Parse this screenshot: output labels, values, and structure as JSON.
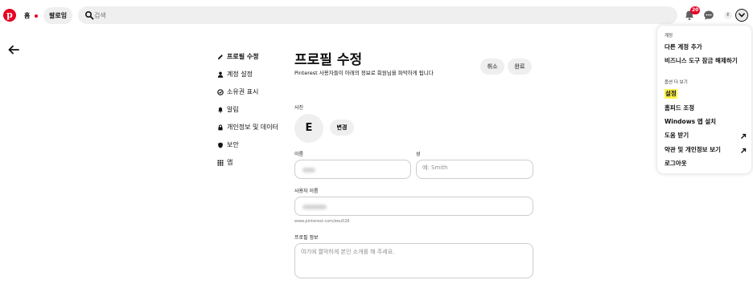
{
  "header": {
    "logo_letter": "p",
    "home_label": "홈",
    "following_label": "팔로잉",
    "search_placeholder": "검색",
    "notification_count": "20",
    "avatar_initial": "E"
  },
  "settings_nav": {
    "items": [
      {
        "label": "프로필 수정",
        "icon": "pencil-icon",
        "active": true
      },
      {
        "label": "계정 설정",
        "icon": "person-icon",
        "active": false
      },
      {
        "label": "소유권 표시",
        "icon": "ownership-icon",
        "active": false
      },
      {
        "label": "알림",
        "icon": "bell-icon",
        "active": false
      },
      {
        "label": "개인정보 및 데이터",
        "icon": "lock-icon",
        "active": false
      },
      {
        "label": "보안",
        "icon": "shield-icon",
        "active": false
      },
      {
        "label": "앱",
        "icon": "grid-icon",
        "active": false
      }
    ]
  },
  "profile_form": {
    "title": "프로필 수정",
    "description": "Pinterest 사용자들이 아래의 정보로 회원님을 파악하게 됩니다",
    "cancel_label": "취소",
    "done_label": "완료",
    "photo_label": "사진",
    "photo_initial": "E",
    "change_label": "변경",
    "first_name_label": "이름",
    "last_name_label": "성",
    "last_name_placeholder": "예: Smith",
    "username_label": "사용자 이름",
    "url_prefix": "www.pinterest.com/eeu526",
    "about_label": "프로필 정보",
    "about_placeholder": "여기에 짤막하게 본인 소개를 해 주세요."
  },
  "account_menu": {
    "section_account": "계정",
    "add_account": "다른 계정 추가",
    "unlock_business": "비즈니스 도구 잠금 해제하기",
    "section_more": "옵션 더 보기",
    "settings": "설정",
    "tune_feed": "홈피드 조정",
    "install_app": "Windows 앱 설치",
    "get_help": "도움 받기",
    "terms_privacy": "약관 및 개인정보 보기",
    "logout": "로그아웃"
  },
  "colors": {
    "brand_red": "#e60023",
    "highlight": "#fff34d",
    "button_gray": "#efefef"
  }
}
